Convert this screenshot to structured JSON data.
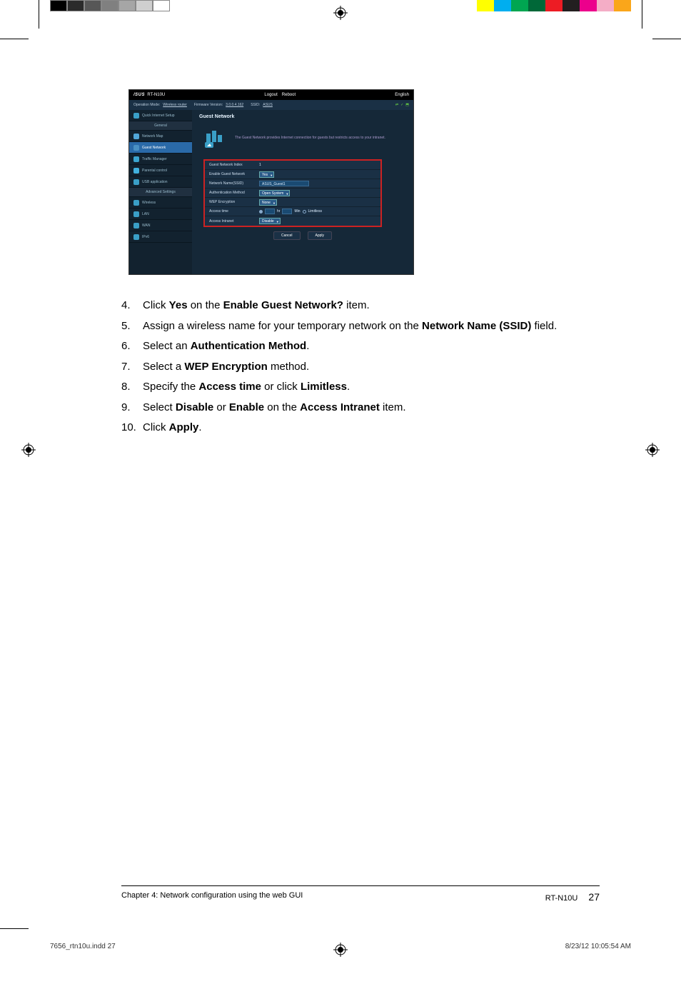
{
  "colorbars": {
    "left": [
      "#000000",
      "#2b2b2b",
      "#575757",
      "#808080",
      "#a6a6a6",
      "#cfcfcf",
      "#ffffff"
    ],
    "right": [
      "#ffff00",
      "#00aeef",
      "#00a651",
      "#006838",
      "#ed1c24",
      "#231f20",
      "#ec008c",
      "#f4adc6",
      "#faa61a"
    ]
  },
  "screenshot": {
    "brand_model": "RT-N10U",
    "top_buttons": {
      "logout": "Logout",
      "reboot": "Reboot",
      "lang": "English"
    },
    "status_line": {
      "op_mode_label": "Operation Mode:",
      "op_mode_value": "Wireless router",
      "fw_label": "Firmware Version:",
      "fw_value": "3.0.0.4.162",
      "ssid_label": "SSID:",
      "ssid_value": "ASUS"
    },
    "sidebar": {
      "qis": "Quick Internet Setup",
      "general_heading": "General",
      "items_general": [
        {
          "label": "Network Map",
          "icon": "#51a7d8"
        },
        {
          "label": "Guest Network",
          "icon": "#4a90c2",
          "hl": true
        },
        {
          "label": "Traffic Manager",
          "icon": "#3aa4cf"
        },
        {
          "label": "Parental control",
          "icon": "#41b1de"
        },
        {
          "label": "USB application",
          "icon": "#3a9fc7"
        }
      ],
      "adv_heading": "Advanced Settings",
      "items_adv": [
        {
          "label": "Wireless",
          "icon": "#3a9fc7"
        },
        {
          "label": "LAN",
          "icon": "#3a9fc7"
        },
        {
          "label": "WAN",
          "icon": "#3a9fc7"
        },
        {
          "label": "IPv6",
          "icon": "#3a9fc7"
        }
      ]
    },
    "main": {
      "title": "Guest Network",
      "desc": "The Guest Network provides Internet connection for guests but restricts access to your intranet.",
      "config_rows": [
        {
          "label": "Guest Network Index",
          "type": "text",
          "value": "1"
        },
        {
          "label": "Enable Guest Network",
          "type": "select",
          "value": "Yes"
        },
        {
          "label": "Network Name(SSID)",
          "type": "input",
          "value": "ASUS_Guest1"
        },
        {
          "label": "Authentication Method",
          "type": "select",
          "value": "Open System"
        },
        {
          "label": "WEP Encryption",
          "type": "select",
          "value": "None"
        },
        {
          "label": "Access time",
          "type": "radio",
          "value_hr": "hr",
          "value_min": "Min",
          "value_limitless": "Limitless"
        },
        {
          "label": "Access Intranet",
          "type": "select",
          "value": "Disable"
        }
      ],
      "cancel": "Cancel",
      "apply": "Apply"
    }
  },
  "instructions": [
    {
      "n": "4.",
      "pre": "Click ",
      "b1": "Yes",
      "mid": " on the ",
      "b2": "Enable Guest Network?",
      "post": " item."
    },
    {
      "n": "5.",
      "pre": "Assign a wireless name for your temporary network on the ",
      "b1": "Network Name (SSID)",
      "post": " field."
    },
    {
      "n": "6.",
      "pre": "Select an ",
      "b1": "Authentication Method",
      "post": "."
    },
    {
      "n": "7.",
      "pre": "Select a ",
      "b1": "WEP Encryption",
      "post": " method."
    },
    {
      "n": "8.",
      "pre": "Specify the ",
      "b1": "Access time",
      "mid": " or click ",
      "b2": "Limitless",
      "post": "."
    },
    {
      "n": "9.",
      "pre": "Select ",
      "b1": "Disable",
      "mid": " or ",
      "b2": "Enable",
      "mid2": " on the ",
      "b3": "Access Intranet",
      "post": " item."
    },
    {
      "n": "10.",
      "pre": "Click ",
      "b1": "Apply",
      "post": "."
    }
  ],
  "footer": {
    "chapter": "Chapter 4: Network configuration using the web GUI",
    "model": "RT-N10U",
    "page": "27"
  },
  "meta": {
    "file": "7656_rtn10u.indd   27",
    "timestamp": "8/23/12   10:05:54 AM"
  }
}
